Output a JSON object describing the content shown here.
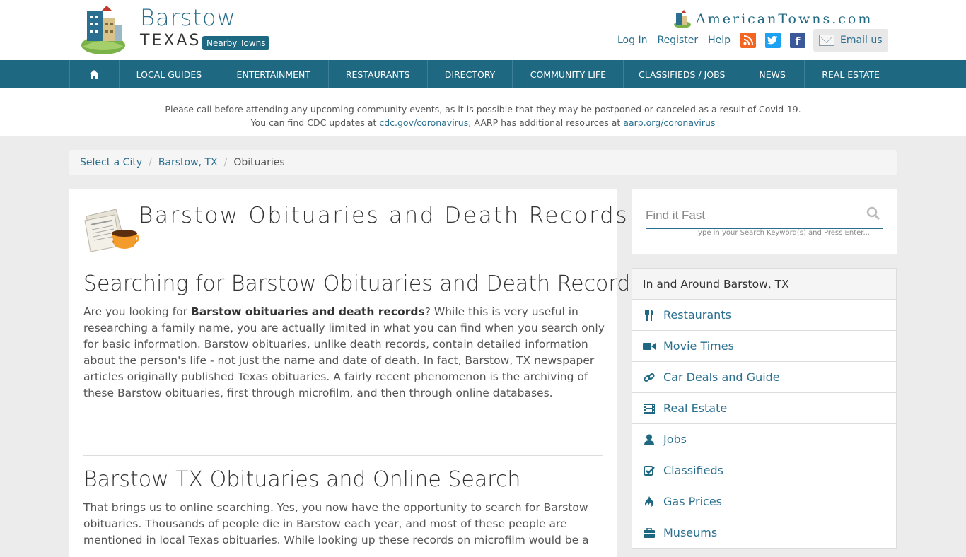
{
  "header": {
    "city": "Barstow",
    "state": "TEXAS",
    "nearby_label": "Nearby Towns",
    "brand": "AmericanTowns.com",
    "links": [
      "Log In",
      "Register",
      "Help"
    ],
    "email_label": "Email us"
  },
  "nav": {
    "items": [
      "LOCAL GUIDES",
      "ENTERTAINMENT",
      "RESTAURANTS",
      "DIRECTORY",
      "COMMUNITY LIFE",
      "CLASSIFIEDS / JOBS",
      "NEWS",
      "REAL ESTATE"
    ]
  },
  "notice": {
    "line1": "Please call before attending any upcoming community events, as it is possible that they may be postponed or canceled as a result of Covid-19.",
    "line2_prefix": "You can find CDC updates at ",
    "cdc_link": "cdc.gov/coronavirus",
    "line2_mid": "; AARP has additional resources at ",
    "aarp_link": "aarp.org/coronavirus"
  },
  "breadcrumb": [
    "Select a City",
    "Barstow, TX",
    "Obituaries"
  ],
  "main": {
    "title": "Barstow Obituaries and Death Records",
    "section1_heading": "Searching for Barstow Obituaries and Death Records",
    "section1_lead": "Are you looking for ",
    "section1_bold": "Barstow obituaries and death records",
    "section1_body": "? While this is very useful in researching a family name, you are actually limited in what you can find when you search only for basic information. Barstow obituaries, unlike death records, contain detailed information about the person's life - not just the name and date of death. In fact, Barstow, TX newspaper articles originally published Texas obituaries. A fairly recent phenomenon is the archiving of these Barstow obituaries, first through microfilm, and then through online databases.",
    "section2_heading": "Barstow TX Obituaries and Online Search",
    "section2_body": "That brings us to online searching. Yes, you now have the opportunity to search for Barstow obituaries. Thousands of people die in Barstow each year, and most of these people are mentioned in local Texas obituaries. While looking up these records on microfilm would be a"
  },
  "search": {
    "placeholder": "Find it Fast",
    "hint": "Type in your Search Keyword(s) and Press Enter..."
  },
  "sidebar": {
    "heading": "In and Around Barstow, TX",
    "items": [
      {
        "label": "Restaurants",
        "icon": "utensils-icon"
      },
      {
        "label": "Movie Times",
        "icon": "video-camera-icon"
      },
      {
        "label": "Car Deals and Guide",
        "icon": "link-icon"
      },
      {
        "label": "Real Estate",
        "icon": "film-icon"
      },
      {
        "label": "Jobs",
        "icon": "user-icon"
      },
      {
        "label": "Classifieds",
        "icon": "check-square-icon"
      },
      {
        "label": "Gas Prices",
        "icon": "fire-icon"
      },
      {
        "label": "Museums",
        "icon": "briefcase-icon"
      }
    ]
  },
  "colors": {
    "brand": "#1f6882",
    "link": "#2a6f8f",
    "rss": "#f26522",
    "twitter": "#1da1f2",
    "facebook": "#3b5998"
  }
}
